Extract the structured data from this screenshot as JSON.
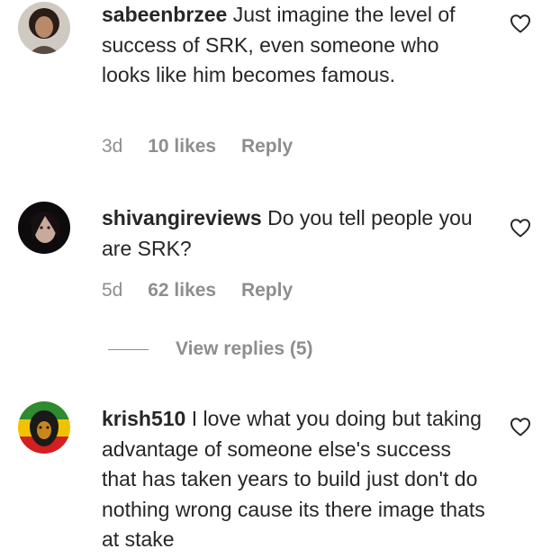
{
  "comments": [
    {
      "username": "sabeenbrzee",
      "text": "Just imagine the level of success of SRK, even someone who looks like him becomes famous.",
      "time": "3d",
      "likes": "10 likes",
      "reply_label": "Reply",
      "avatar_icon": "avatar-photo",
      "like_icon": "heart-outline-icon"
    },
    {
      "username": "shivangireviews",
      "text": "Do you tell people you are SRK?",
      "time": "5d",
      "likes": "62 likes",
      "reply_label": "Reply",
      "avatar_icon": "avatar-photo",
      "like_icon": "heart-outline-icon"
    },
    {
      "username": "krish510",
      "text": "I love what you doing but taking advantage of someone else's success that has taken years to build just don't do nothing wrong cause its there image thats at stake",
      "avatar_icon": "avatar-lion-image",
      "like_icon": "heart-outline-icon"
    }
  ],
  "view_replies_label": "View replies (5)",
  "colors": {
    "text": "#262626",
    "secondary": "#8e8e8e",
    "background": "#ffffff"
  }
}
